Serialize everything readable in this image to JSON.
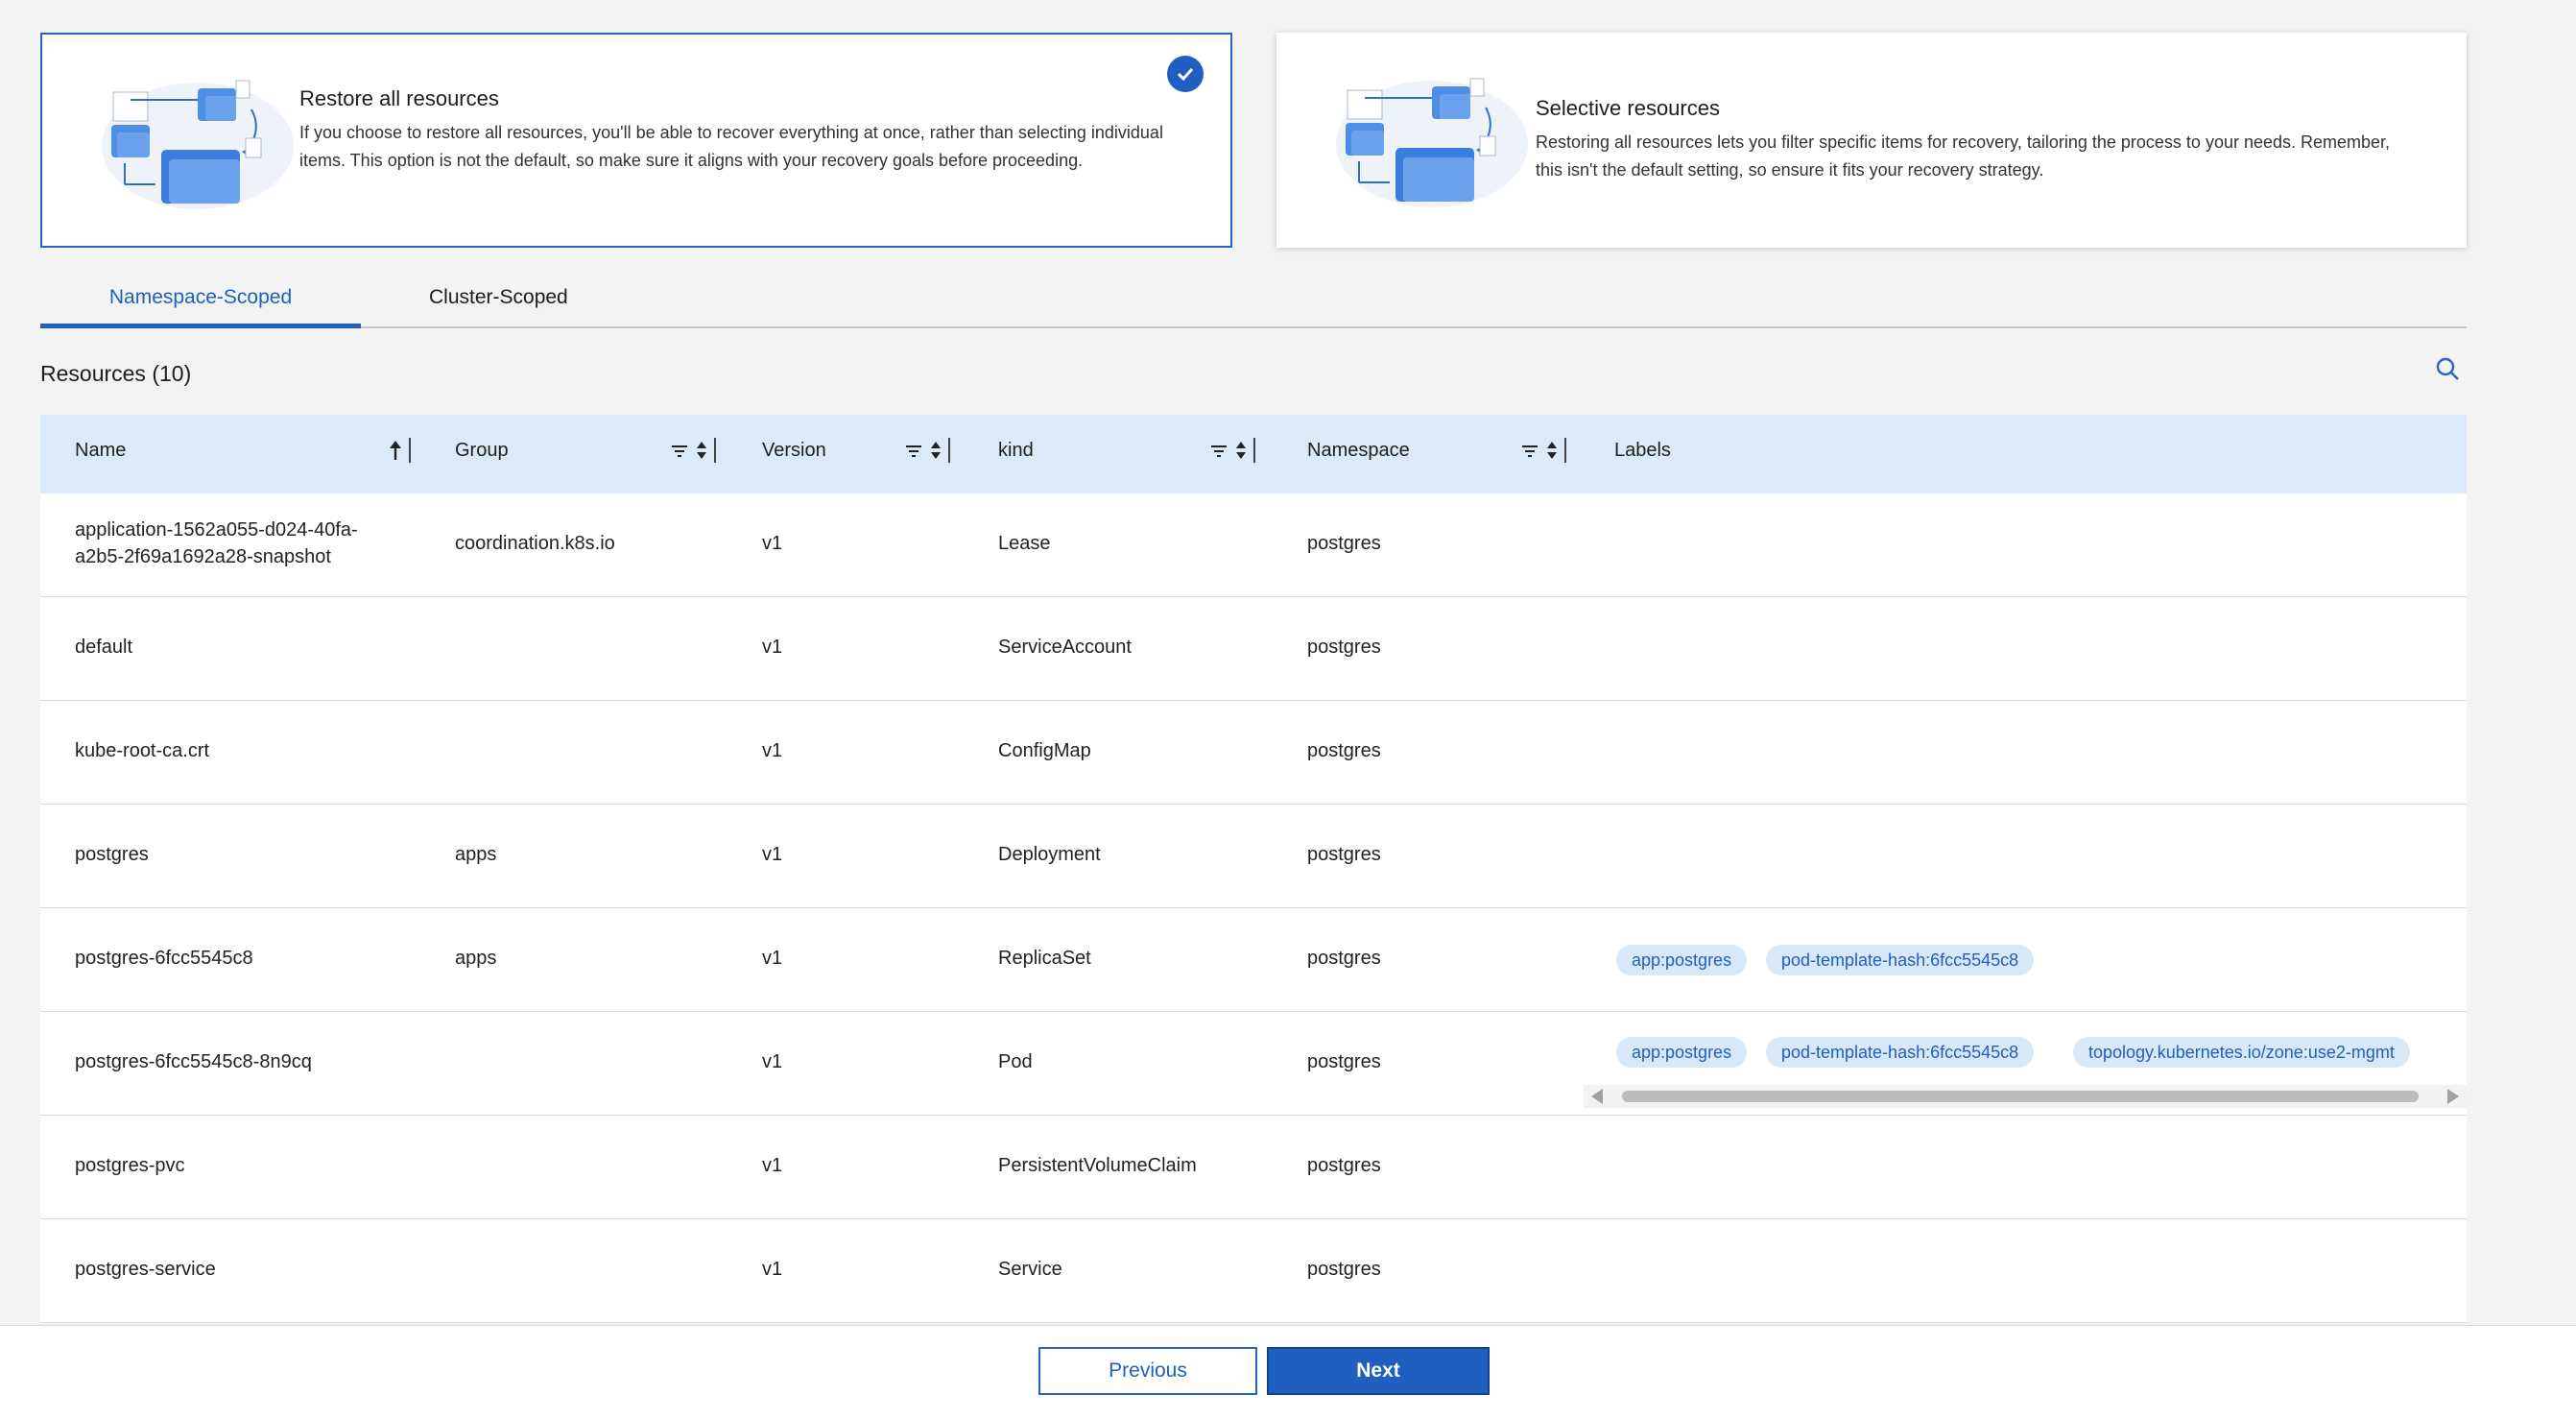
{
  "cards": [
    {
      "title": "Restore all resources",
      "description": "If you choose to restore all resources, you'll be able to recover everything at once, rather than selecting individual items. This option is not the default, so make sure it aligns with your recovery goals before proceeding.",
      "selected": true
    },
    {
      "title": "Selective resources",
      "description": "Restoring all resources lets you filter specific items for recovery, tailoring the process to your needs. Remember, this isn't the default setting, so ensure it fits your recovery strategy.",
      "selected": false
    }
  ],
  "tabs": [
    "Namespace-Scoped",
    "Cluster-Scoped"
  ],
  "resources_title": "Resources (10)",
  "columns": {
    "name": "Name",
    "group": "Group",
    "version": "Version",
    "kind": "kind",
    "namespace": "Namespace",
    "labels": "Labels"
  },
  "rows": [
    {
      "name": "application-1562a055-d024-40fa-a2b5-2f69a1692a28-snapshot",
      "group": "coordination.k8s.io",
      "version": "v1",
      "kind": "Lease",
      "namespace": "postgres",
      "labels": []
    },
    {
      "name": "default",
      "group": "",
      "version": "v1",
      "kind": "ServiceAccount",
      "namespace": "postgres",
      "labels": []
    },
    {
      "name": "kube-root-ca.crt",
      "group": "",
      "version": "v1",
      "kind": "ConfigMap",
      "namespace": "postgres",
      "labels": []
    },
    {
      "name": "postgres",
      "group": "apps",
      "version": "v1",
      "kind": "Deployment",
      "namespace": "postgres",
      "labels": []
    },
    {
      "name": "postgres-6fcc5545c8",
      "group": "apps",
      "version": "v1",
      "kind": "ReplicaSet",
      "namespace": "postgres",
      "labels": [
        "app:postgres",
        "pod-template-hash:6fcc5545c8"
      ]
    },
    {
      "name": "postgres-6fcc5545c8-8n9cq",
      "group": "",
      "version": "v1",
      "kind": "Pod",
      "namespace": "postgres",
      "labels": [
        "app:postgres",
        "pod-template-hash:6fcc5545c8",
        "topology.kubernetes.io/zone:use2-mgmt"
      ]
    },
    {
      "name": "postgres-pvc",
      "group": "",
      "version": "v1",
      "kind": "PersistentVolumeClaim",
      "namespace": "postgres",
      "labels": []
    },
    {
      "name": "postgres-service",
      "group": "",
      "version": "v1",
      "kind": "Service",
      "namespace": "postgres",
      "labels": []
    }
  ],
  "footer": {
    "previous": "Previous",
    "next": "Next"
  },
  "colors": {
    "accent": "#1f5fbf",
    "header_bg": "#dbeaf8",
    "chip_bg": "#d9e8f7"
  }
}
